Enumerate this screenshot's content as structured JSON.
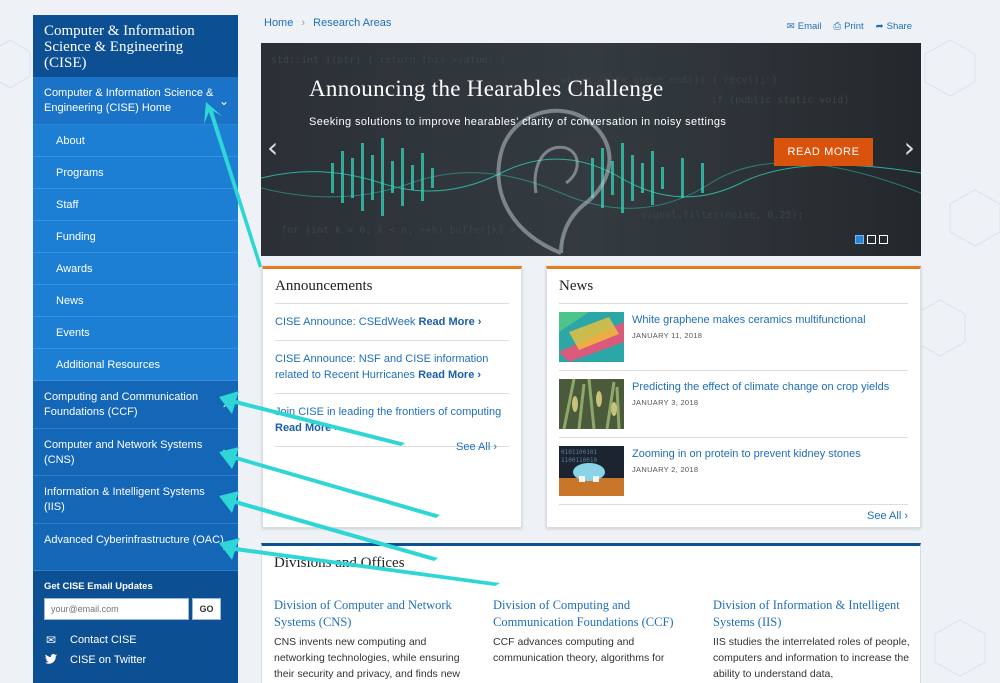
{
  "sidebar": {
    "title": "Computer & Information Science & Engineering (CISE)",
    "home": "Computer & Information Science & Engineering (CISE) Home",
    "sub_items": [
      "About",
      "Programs",
      "Staff",
      "Funding",
      "Awards",
      "News",
      "Events",
      "Additional Resources"
    ],
    "divisions": [
      "Computing and Communication Foundations (CCF)",
      "Computer and Network Systems (CNS)",
      "Information & Intelligent Systems (IIS)",
      "Advanced Cyberinfrastructure (OAC)"
    ],
    "email_title": "Get CISE Email Updates",
    "email_placeholder": "your@email.com",
    "go_label": "GO",
    "contact": "Contact CISE",
    "twitter": "CISE on Twitter"
  },
  "breadcrumb": {
    "home": "Home",
    "sep": "›",
    "current": "Research Areas"
  },
  "utility": {
    "email": "Email",
    "print": "Print",
    "share": "Share"
  },
  "hero": {
    "title": "Announcing the Hearables Challenge",
    "subtitle": "Seeking solutions to improve hearables' clarity of conversation in noisy settings",
    "button": "READ MORE",
    "prev": "‹",
    "next": "›",
    "active_slide": 1
  },
  "announcements": {
    "title": "Announcements",
    "items": [
      {
        "text": "CISE Announce: CSEdWeek ",
        "more": "Read More ›"
      },
      {
        "text": "CISE Announce: NSF and CISE information related to Recent Hurricanes ",
        "more": "Read More ›"
      },
      {
        "text": "Join CISE in leading the frontiers of computing ",
        "more": "Read More ›"
      }
    ],
    "see_all": "See All ›"
  },
  "news": {
    "title": "News",
    "items": [
      {
        "title": "White graphene makes ceramics multifunctional",
        "date": "JANUARY 11, 2018"
      },
      {
        "title": "Predicting the effect of climate change on crop yields",
        "date": "JANUARY 3, 2018"
      },
      {
        "title": "Zooming in on protein to prevent kidney stones",
        "date": "JANUARY 2, 2018"
      }
    ],
    "see_all": "See All ›"
  },
  "divisions": {
    "title": "Divisions and Offices",
    "items": [
      {
        "name": "Division of Computer and Network Systems (CNS)",
        "desc": "CNS invents new computing and networking technologies, while ensuring their security and privacy, and finds new"
      },
      {
        "name": "Division of Computing and Communication Foundations (CCF)",
        "desc": "CCF advances computing and communication theory, algorithms for"
      },
      {
        "name": "Division of Information & Intelligent Systems (IIS)",
        "desc": "IIS studies the interrelated roles of people, computers and information to increase the ability to understand data,"
      }
    ]
  },
  "colors": {
    "sidebar": "#1565b0",
    "accent": "#e97b1c",
    "button": "#d9530d",
    "link": "#1f6fb7",
    "annotation": "#2fd6d6"
  }
}
